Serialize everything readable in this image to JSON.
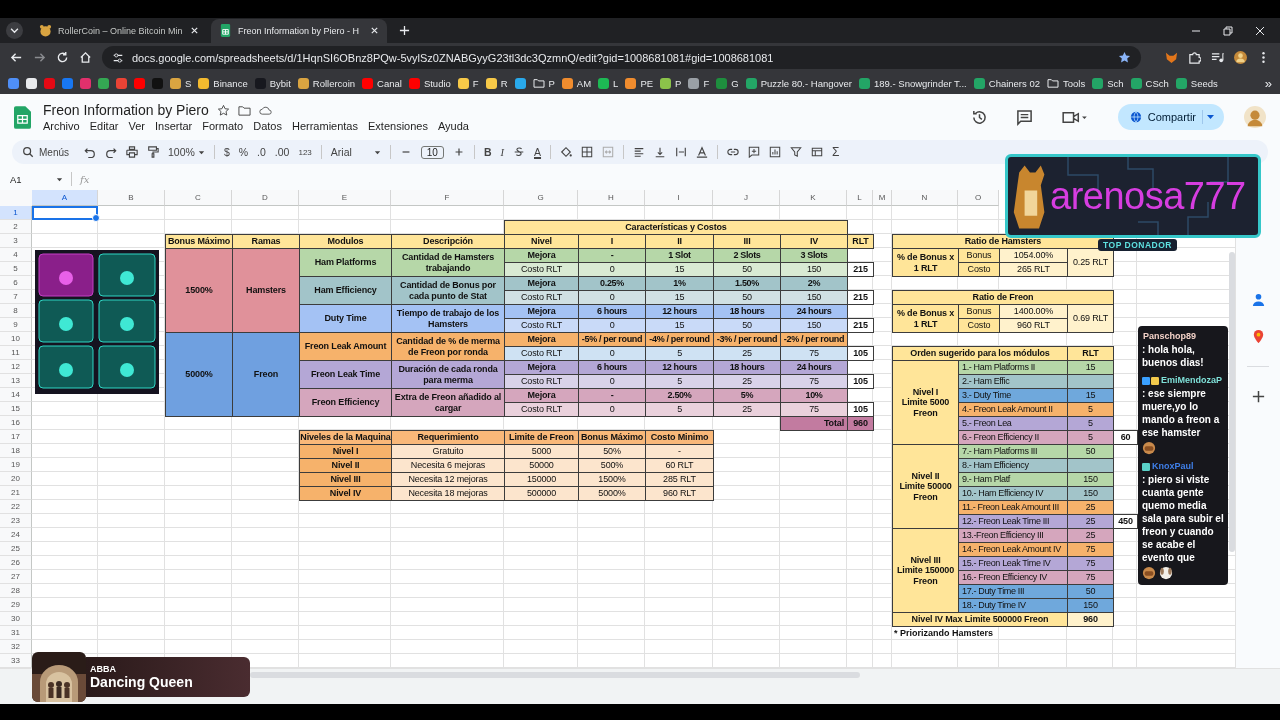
{
  "browser": {
    "tabs": [
      {
        "title": "RollerCoin – Online Bitcoin Min",
        "selected": false
      },
      {
        "title": "Freon Information by Piero - H",
        "selected": true
      }
    ],
    "url": "docs.google.com/spreadsheets/d/1HqnSI6OBnz8PQw-5vylSz0ZNABGyyG23tl3dc3QzmnQ/edit?gid=1008681081#gid=1008681081",
    "bookmarks": [
      {
        "kind": "site",
        "color": "#4f8ff7"
      },
      {
        "kind": "site",
        "color": "#e8eaed"
      },
      {
        "kind": "site",
        "color": "#e50914"
      },
      {
        "kind": "site",
        "color": "#1877f2"
      },
      {
        "kind": "site",
        "color": "#e1306c"
      },
      {
        "kind": "site",
        "color": "#34a853"
      },
      {
        "kind": "site",
        "color": "#ea4335"
      },
      {
        "kind": "site",
        "color": "#ff0000"
      },
      {
        "kind": "site",
        "color": "#111111"
      },
      {
        "kind": "site",
        "label": "S",
        "color": "#d9a441"
      },
      {
        "kind": "site",
        "label": "Binance",
        "color": "#f3ba2f"
      },
      {
        "kind": "site",
        "label": "Bybit",
        "color": "#17181e"
      },
      {
        "kind": "site",
        "label": "Rollercoin",
        "color": "#d9a441"
      },
      {
        "kind": "site",
        "label": "Canal",
        "color": "#ff0000"
      },
      {
        "kind": "site",
        "label": "Studio",
        "color": "#ff0000"
      },
      {
        "kind": "site",
        "label": "F",
        "color": "#f7c948"
      },
      {
        "kind": "site",
        "label": "R",
        "color": "#f7c948"
      },
      {
        "kind": "site",
        "color": "#29a9eb"
      },
      {
        "kind": "folder",
        "label": "P"
      },
      {
        "kind": "site",
        "label": "AM",
        "color": "#f08c2e"
      },
      {
        "kind": "site",
        "label": "L",
        "color": "#1db954"
      },
      {
        "kind": "site",
        "label": "PE",
        "color": "#f08c2e"
      },
      {
        "kind": "site",
        "label": "P",
        "color": "#8bc34a"
      },
      {
        "kind": "site",
        "label": "F",
        "color": "#9aa0a6"
      },
      {
        "kind": "site",
        "label": "G",
        "color": "#1e8e3e"
      },
      {
        "kind": "site",
        "label": "Puzzle 80.- Hangover",
        "color": "#23a566"
      },
      {
        "kind": "site",
        "label": "189.- Snowgrinder T...",
        "color": "#23a566"
      },
      {
        "kind": "site",
        "label": "Chainers 02",
        "color": "#23a566"
      },
      {
        "kind": "folder",
        "label": "Tools"
      },
      {
        "kind": "site",
        "label": "Sch",
        "color": "#23a566"
      },
      {
        "kind": "site",
        "label": "CSch",
        "color": "#23a566"
      },
      {
        "kind": "site",
        "label": "Seeds",
        "color": "#23a566"
      }
    ],
    "more": "»"
  },
  "sheets": {
    "title": "Freon Information by Piero",
    "menus": [
      "Archivo",
      "Editar",
      "Ver",
      "Insertar",
      "Formato",
      "Datos",
      "Herramientas",
      "Extensiones",
      "Ayuda"
    ],
    "share": "Compartir",
    "toolbar": {
      "search": "Menús",
      "zoom": "100%",
      "currency": "$",
      "percent": "%",
      "decrease_decimals": ".0",
      "increase_decimals": ".00",
      "number_format": "123",
      "font": "Arial",
      "font_size": "10",
      "bold": "B",
      "italic": "I",
      "text_color": "A",
      "functions": "Σ"
    },
    "name_box": "A1",
    "formula_label": "fx"
  },
  "grid": {
    "columns": [
      "A",
      "B",
      "C",
      "D",
      "E",
      "F",
      "G",
      "H",
      "I",
      "J",
      "K",
      "L",
      "M",
      "N",
      "O"
    ],
    "row_numbers": [
      "1",
      "2",
      "3",
      "4",
      "5",
      "6",
      "7",
      "8",
      "9",
      "10",
      "11",
      "12",
      "13",
      "14",
      "15",
      "16",
      "17",
      "18",
      "19",
      "20",
      "21",
      "22",
      "23",
      "24",
      "25",
      "26",
      "27",
      "28",
      "29",
      "30",
      "31",
      "32",
      "33"
    ]
  },
  "main_table": {
    "group_header": "Características y Costos",
    "columns": [
      "Bonus Máximo",
      "Ramas",
      "Modulos",
      "Descripción",
      "Nivel",
      "I",
      "II",
      "III",
      "IV",
      "RLT"
    ],
    "branches": [
      {
        "bonus": "1500%",
        "name": "Hamsters",
        "color": "#e0919a",
        "modules": [
          {
            "name": "Ham Platforms",
            "description": "Cantidad de Hamsters trabajando",
            "color": "#b6d7a8",
            "rows": [
              {
                "kind": "upgrade",
                "label": "Mejora",
                "color": "#b6d7a8",
                "values": [
                  "-",
                  "1 Slot",
                  "2 Slots",
                  "3 Slots"
                ]
              },
              {
                "kind": "cost",
                "label": "Costo RLT",
                "color": "#d9ead3",
                "values": [
                  "0",
                  "15",
                  "50",
                  "150"
                ],
                "total": "215"
              }
            ]
          },
          {
            "name": "Ham Efficiency",
            "description": "Cantidad de Bonus por cada punto de Stat",
            "color": "#a2c4c9",
            "rows": [
              {
                "kind": "upgrade",
                "label": "Mejora",
                "color": "#a2c4c9",
                "values": [
                  "0.25%",
                  "1%",
                  "1.50%",
                  "2%"
                ]
              },
              {
                "kind": "cost",
                "label": "Costo RLT",
                "color": "#d0e0e3",
                "values": [
                  "0",
                  "15",
                  "50",
                  "150"
                ],
                "total": "215"
              }
            ]
          },
          {
            "name": "Duty Time",
            "description": "Tiempo de trabajo de los Hamsters",
            "color": "#a4c2f4",
            "rows": [
              {
                "kind": "upgrade",
                "label": "Mejora",
                "color": "#a4c2f4",
                "values": [
                  "6 hours",
                  "12 hours",
                  "18 hours",
                  "24 hours"
                ]
              },
              {
                "kind": "cost",
                "label": "Costo RLT",
                "color": "#c9daf8",
                "values": [
                  "0",
                  "15",
                  "50",
                  "150"
                ],
                "total": "215"
              }
            ]
          }
        ]
      },
      {
        "bonus": "5000%",
        "name": "Freon",
        "color": "#6fa0e0",
        "modules": [
          {
            "name": "Freon Leak Amount",
            "description": "Cantidad de % de merma de Freon por ronda",
            "color": "#f6b26b",
            "rows": [
              {
                "kind": "upgrade",
                "label": "Mejora",
                "color": "#f6b26b",
                "values": [
                  "-5% / per round",
                  "-4% / per round",
                  "-3% / per round",
                  "-2% / per round"
                ]
              },
              {
                "kind": "cost",
                "label": "Costo RLT",
                "color": "#cfe2f3",
                "values": [
                  "0",
                  "5",
                  "25",
                  "75"
                ],
                "total": "105"
              }
            ]
          },
          {
            "name": "Freon Leak Time",
            "description": "Duración de cada ronda para merma",
            "color": "#b4a7d6",
            "rows": [
              {
                "kind": "upgrade",
                "label": "Mejora",
                "color": "#b4a7d6",
                "values": [
                  "6 hours",
                  "12 hours",
                  "18 hours",
                  "24 hours"
                ]
              },
              {
                "kind": "cost",
                "label": "Costo RLT",
                "color": "#d9d2e9",
                "values": [
                  "0",
                  "5",
                  "25",
                  "75"
                ],
                "total": "105"
              }
            ]
          },
          {
            "name": "Freon Efficiency",
            "description": "Extra de Freon añadido al cargar",
            "color": "#d5a6bd",
            "rows": [
              {
                "kind": "upgrade",
                "label": "Mejora",
                "color": "#d5a6bd",
                "values": [
                  "-",
                  "2.50%",
                  "5%",
                  "10%"
                ]
              },
              {
                "kind": "cost",
                "label": "Costo RLT",
                "color": "#ead1dc",
                "values": [
                  "0",
                  "5",
                  "25",
                  "75"
                ],
                "total": "105"
              }
            ]
          }
        ]
      }
    ],
    "total_label": "Total",
    "total": "960"
  },
  "levels_table": {
    "columns": [
      "Niveles de la Maquina",
      "Requerimiento",
      "Limite de Freon",
      "Bonus Máximo",
      "Costo Minimo"
    ],
    "rows": [
      [
        "Nivel I",
        "Gratuito",
        "5000",
        "50%",
        "-"
      ],
      [
        "Nivel II",
        "Necesita 6 mejoras",
        "50000",
        "500%",
        "60 RLT"
      ],
      [
        "Nivel III",
        "Necesita 12 mejoras",
        "150000",
        "1500%",
        "285 RLT"
      ],
      [
        "Nivel IV",
        "Necesita 18 mejoras",
        "500000",
        "5000%",
        "960 RLT"
      ]
    ]
  },
  "ratios": [
    {
      "title": "Ratio de Hamsters",
      "label": "% de Bonus x 1 RLT",
      "rows": [
        {
          "label": "Bonus",
          "value": "1054.00%"
        },
        {
          "label": "Costo",
          "value": "265 RLT"
        }
      ],
      "ratio": "0.25 RLT"
    },
    {
      "title": "Ratio de Freon",
      "label": "% de Bonus x 1 RLT",
      "rows": [
        {
          "label": "Bonus",
          "value": "1400.00%"
        },
        {
          "label": "Costo",
          "value": "960 RLT"
        }
      ],
      "ratio": "0.69 RLT"
    }
  ],
  "order_table": {
    "title": "Orden sugerido para los módulos",
    "rlt_header": "RLT",
    "levels": [
      {
        "lines": [
          "Nivel I",
          "Limite 5000",
          "Freon"
        ],
        "subtotal": "60",
        "items": [
          {
            "name": "1.- Ham Platforms II",
            "rlt": "15",
            "color": "#b6d7a8"
          },
          {
            "name": "2.- Ham Effic",
            "color": "#a2c4c9"
          },
          {
            "name": "3.- Duty Time",
            "rlt": "15",
            "color": "#6fa8dc"
          },
          {
            "name": "4.- Freon Leak Amount II",
            "rlt": "5",
            "color": "#f6b26b"
          },
          {
            "name": "5.- Freon Lea",
            "rlt": "5",
            "color": "#b4a7d6"
          },
          {
            "name": "6.- Freon Efficiency II",
            "rlt": "5",
            "color": "#d5a6bd"
          }
        ]
      },
      {
        "lines": [
          "Nivel II",
          "Limite 50000",
          "Freon"
        ],
        "subtotal": "450",
        "items": [
          {
            "name": "7.- Ham Platforms III",
            "rlt": "50",
            "color": "#b6d7a8"
          },
          {
            "name": "8.- Ham Efficiency",
            "color": "#a2c4c9"
          },
          {
            "name": "9.- Ham Platf",
            "rlt": "150",
            "color": "#b6d7a8"
          },
          {
            "name": "10.- Ham Efficiency IV",
            "rlt": "150",
            "color": "#a2c4c9"
          },
          {
            "name": "11.- Freon Leak Amount III",
            "rlt": "25",
            "color": "#f6b26b"
          },
          {
            "name": "12.- Freon Leak Time III",
            "rlt": "25",
            "color": "#b4a7d6"
          }
        ]
      },
      {
        "lines": [
          "Nivel III",
          "Limite 150000",
          "Freon"
        ],
        "items": [
          {
            "name": "13.-Freon Efficiency III",
            "rlt": "25",
            "color": "#d5a6bd"
          },
          {
            "name": "14.- Freon Leak Amount IV",
            "rlt": "75",
            "color": "#f6b26b"
          },
          {
            "name": "15.- Freon Leak Time IV",
            "rlt": "75",
            "color": "#b4a7d6"
          },
          {
            "name": "16.- Freon Efficiency IV",
            "rlt": "75",
            "color": "#d5a6bd"
          },
          {
            "name": "17.- Duty Time III",
            "rlt": "50",
            "color": "#6fa8dc"
          },
          {
            "name": "18.- Duty Time IV",
            "rlt": "150",
            "color": "#6fa8dc"
          }
        ]
      }
    ],
    "final": {
      "label": "Nivel IV Max Limite 500000 Freon",
      "rlt": "960"
    },
    "note": "* Priorizando Hamsters"
  },
  "stream": {
    "donor": {
      "name": "arenosa777",
      "badge": "TOP DONADOR"
    },
    "chat": [
      {
        "user": "Panschop89",
        "color": "#f3d2c8",
        "text": ": hola hola, buenos dias!"
      },
      {
        "user": "EmiMendozaP",
        "color": "#7fe0d8",
        "badges": [
          {
            "color": "#3aa0ff"
          },
          {
            "color": "#f2c94c"
          }
        ],
        "text": ": ese siempre muere,yo lo mando a freon a ese hamster",
        "emotes": [
          {
            "kind": "face"
          }
        ]
      },
      {
        "user": "KnoxPaul",
        "color": "#3f7fe8",
        "badges": [
          {
            "color": "#5ad1c8"
          }
        ],
        "text": ": piero si viste cuanta gente quemo media sala para subir el freon y cuando se acabe el evento que",
        "emotes": [
          {
            "kind": "face"
          },
          {
            "kind": "pet"
          }
        ]
      }
    ],
    "now_playing": {
      "artist": "ABBA",
      "title": "Dancing Queen"
    }
  }
}
